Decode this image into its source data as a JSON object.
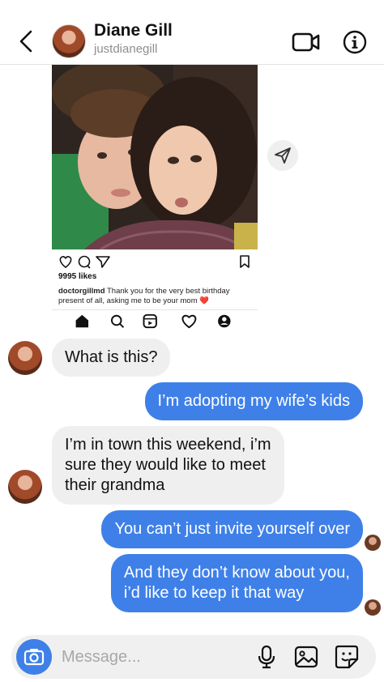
{
  "header": {
    "name": "Diane Gill",
    "username": "justdianegill"
  },
  "shared_post": {
    "likes": "9995 likes",
    "caption_user": "doctorgillmd",
    "caption_text": "Thank you for the very best birthday present of all, asking me to be your mom",
    "caption_emoji": "❤️"
  },
  "messages": [
    {
      "from": "them",
      "text": "What is this?"
    },
    {
      "from": "me",
      "text": "I’m adopting my wife’s kids"
    },
    {
      "from": "them",
      "line1": "I’m in town this weekend, i’m",
      "line2": "sure they would like to meet",
      "line3": "their grandma"
    },
    {
      "from": "me",
      "text": "You can’t just invite yourself over"
    },
    {
      "from": "me",
      "line1": "And they don’t know about you,",
      "line2": "i’d like to keep it that way"
    }
  ],
  "composer": {
    "placeholder": "Message..."
  },
  "icons": {
    "back": "chevron-left-icon",
    "video": "video-camera-icon",
    "info": "info-icon",
    "share": "paper-plane-icon",
    "camera": "camera-icon",
    "mic": "microphone-icon",
    "gallery": "image-icon",
    "sticker": "sticker-icon"
  },
  "colors": {
    "accent": "#3f80e8",
    "incoming_bubble": "#efefef",
    "heart": "#e0245e"
  }
}
